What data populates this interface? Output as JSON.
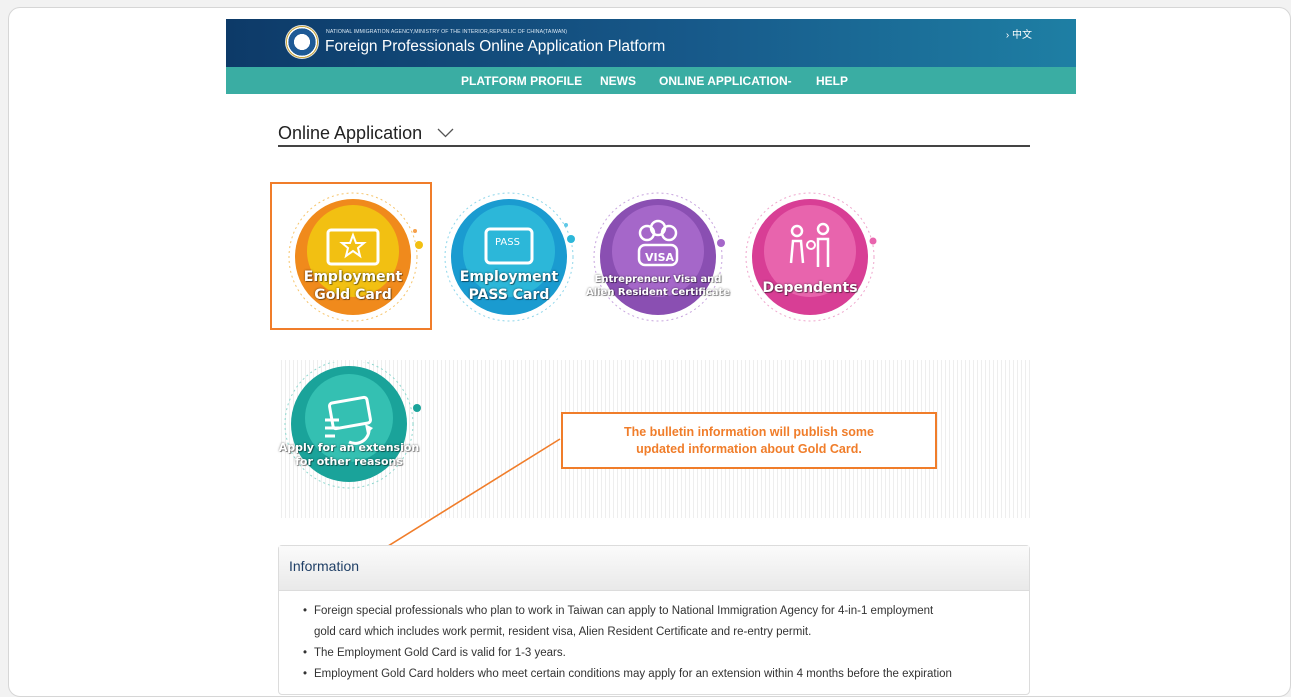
{
  "header": {
    "agency": "NATIONAL IMMIGRATION AGENCY,MINISTRY OF THE INTERIOR,REPUBLIC OF CHINA(TAIWAN)",
    "title": "Foreign Professionals Online Application Platform",
    "lang_link": "› 中文"
  },
  "nav": {
    "items": [
      "PLATFORM PROFILE",
      "NEWS",
      "ONLINE APPLICATION-",
      "HELP"
    ]
  },
  "section": {
    "title": "Online Application"
  },
  "services": [
    {
      "line1": "Employment",
      "line2": "Gold Card",
      "color": "#f08a1c",
      "inner": "#f2c012"
    },
    {
      "line1": "Employment",
      "line2": "PASS Card",
      "color": "#1a9bd0",
      "inner": "#2cb7d9",
      "badge": "PASS"
    },
    {
      "line1": "Entrepreneur Visa and",
      "line2": "Alien Resident Certificate",
      "color": "#8a4fb2",
      "inner": "#a567c9",
      "badge": "VISA"
    },
    {
      "line1": "Dependents",
      "line2": "",
      "color": "#d83e95",
      "inner": "#e864ad"
    },
    {
      "line1": "Apply for an extension",
      "line2": "for other reasons",
      "color": "#1aa39a",
      "inner": "#34c0b2"
    }
  ],
  "callout": {
    "text_line1": "The bulletin information will publish some",
    "text_line2": "updated information about Gold Card."
  },
  "info": {
    "title": "Information",
    "items": [
      "Foreign special professionals who plan to work in Taiwan can apply to National Immigration Agency for 4-in-1 employment",
      "gold card which includes work permit, resident visa, Alien Resident Certificate and re-entry permit.",
      "The Employment Gold Card is valid for 1-3 years.",
      "Employment Gold Card holders who meet certain conditions may apply for an extension within 4 months before the expiration"
    ]
  },
  "colors": {
    "header_dark": "#0d3a68",
    "nav_teal": "#3aada3",
    "accent_orange": "#f07d2a"
  }
}
